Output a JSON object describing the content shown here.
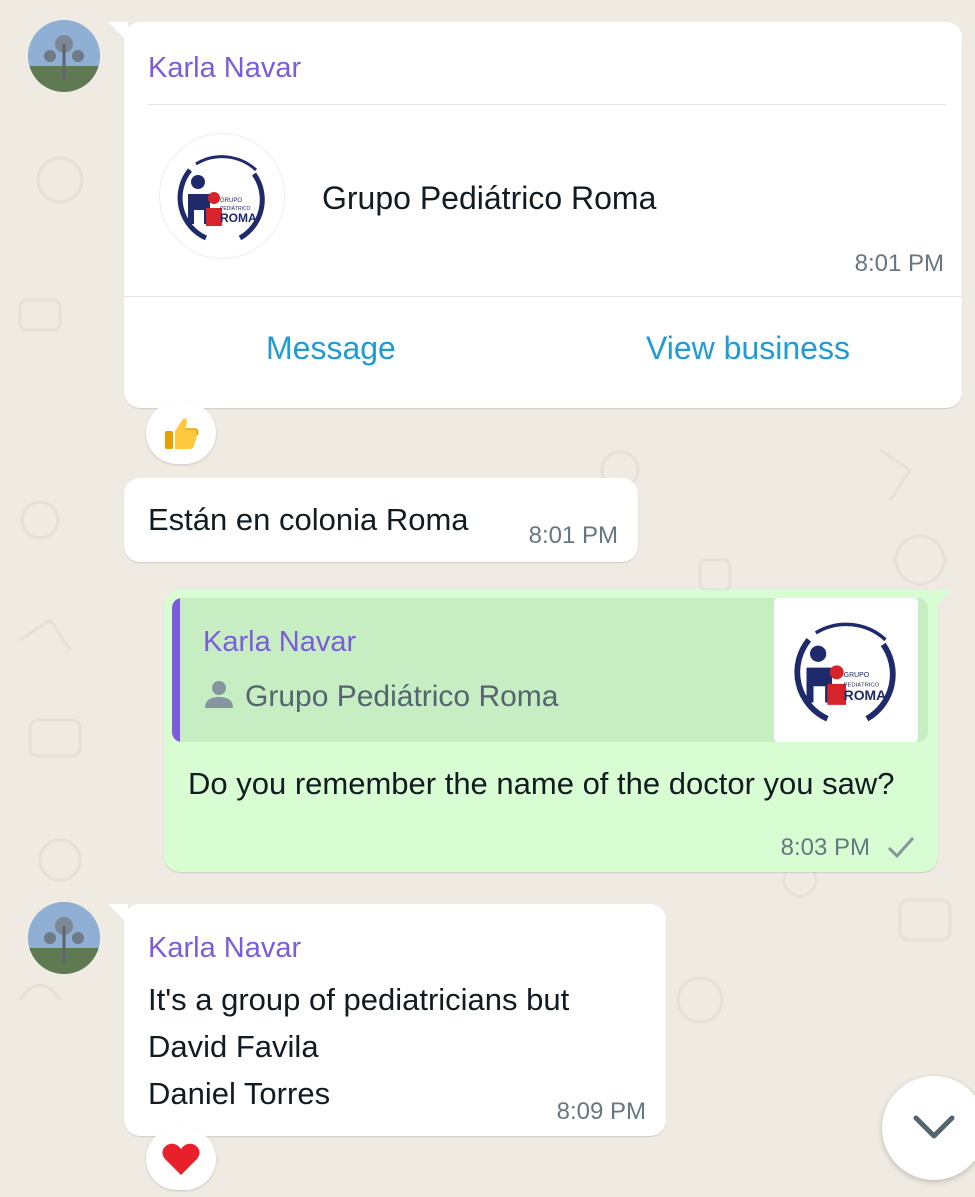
{
  "messages": {
    "card": {
      "sender": "Karla Navar",
      "business_name": "Grupo Pediátrico Roma",
      "time": "8:01 PM",
      "actions": [
        "Message",
        "View business"
      ],
      "reaction": "thumbs-up"
    },
    "text1": {
      "text": "Están en colonia Roma",
      "time": "8:01 PM"
    },
    "reply": {
      "quote_sender": "Karla Navar",
      "quote_text": "Grupo Pediátrico Roma",
      "text": "Do you remember the name of the doctor you saw?",
      "time": "8:03 PM",
      "status": "sent"
    },
    "text2": {
      "sender": "Karla Navar",
      "lines": [
        "It's a group of pediatricians but",
        "David Favila",
        "Daniel Torres"
      ],
      "time": "8:09 PM",
      "reaction": "heart"
    }
  },
  "logo": {
    "line1": "GRUPO",
    "line2": "PEDIÁTRICO",
    "line3": "ROMA"
  },
  "colors": {
    "background": "#efeae2",
    "incoming": "#ffffff",
    "outgoing": "#d9fdd3",
    "sender_name": "#7c5cdb",
    "link": "#1f9bd6",
    "timestamp": "#667781"
  },
  "icons": {
    "scroll_down": "chevron-down-icon",
    "contact": "person-icon",
    "sent": "checkmark-icon"
  }
}
